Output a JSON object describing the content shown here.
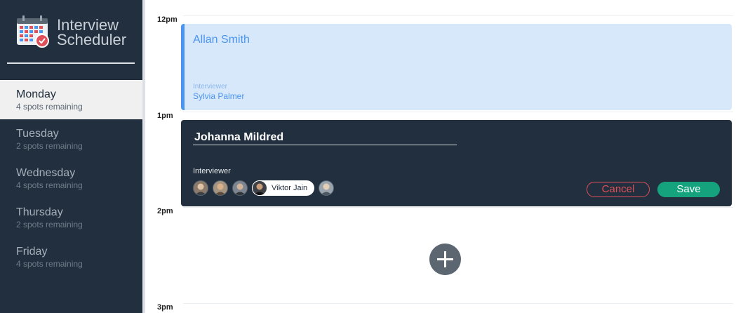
{
  "brand": {
    "title": "Interview Scheduler"
  },
  "days": [
    {
      "name": "Monday",
      "spots": "4 spots remaining"
    },
    {
      "name": "Tuesday",
      "spots": "2 spots remaining"
    },
    {
      "name": "Wednesday",
      "spots": "4 spots remaining"
    },
    {
      "name": "Thursday",
      "spots": "2 spots remaining"
    },
    {
      "name": "Friday",
      "spots": "4 spots remaining"
    }
  ],
  "selected_day": "Monday",
  "hours": [
    "12pm",
    "1pm",
    "2pm",
    "3pm"
  ],
  "appointment": {
    "student": "Allan Smith",
    "interviewer_label": "Interviewer",
    "interviewer": "Sylvia Palmer"
  },
  "form": {
    "student_value": "Johanna Mildred",
    "interviewer_label": "Interviewer",
    "selected_interviewer": "Viktor Jain",
    "cancel_label": "Cancel",
    "save_label": "Save"
  },
  "icons": {
    "logo": "calendar-check-icon",
    "add": "plus-icon"
  },
  "colors": {
    "sidebar": "#222f3e",
    "appointment_bg": "#d8e8fb",
    "appointment_accent": "#4a95f0",
    "cancel": "#e0505a",
    "save": "#15a37e"
  }
}
